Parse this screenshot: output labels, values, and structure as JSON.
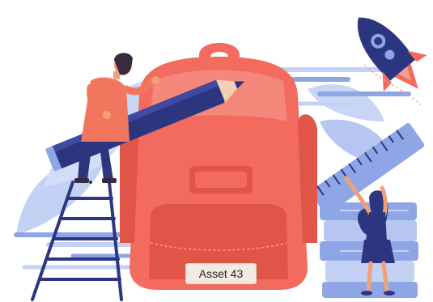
{
  "illustration": {
    "label": "Asset 43",
    "colors": {
      "backpack": "#f26b5e",
      "backpack_dark": "#e05548",
      "backpack_light": "#f6a092",
      "navy": "#2c3680",
      "periwinkle": "#8fa6e6",
      "light_blue": "#c3d1f4",
      "skin": "#f0a07a",
      "hair": "#3a2a40",
      "shirt": "#f2765e"
    },
    "icons": [
      "backpack",
      "pencil",
      "rocket",
      "ruler",
      "ladder",
      "man-figure",
      "woman-figure",
      "books-stack",
      "leaves"
    ]
  }
}
